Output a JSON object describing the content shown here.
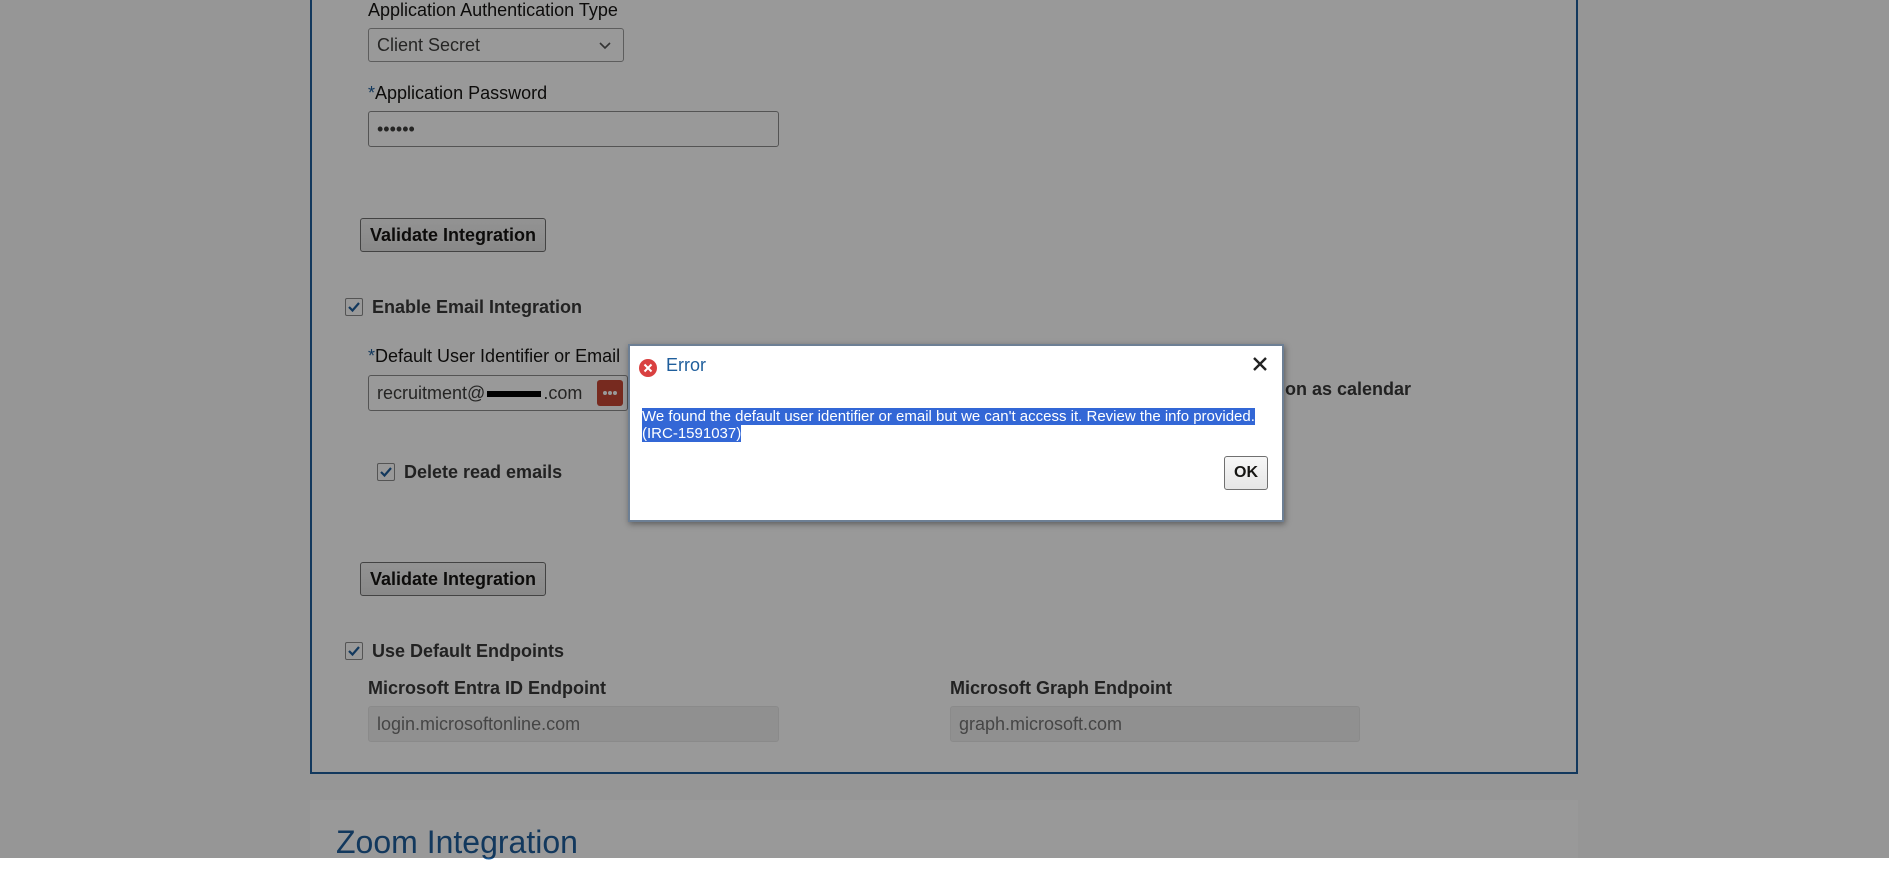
{
  "form": {
    "auth_type_label": "Application Authentication Type",
    "auth_type_value": "Client Secret",
    "password_label": "Application Password",
    "password_value": "••••••",
    "required_marker": "*",
    "validate_button_1": "Validate Integration",
    "enable_email_label": "Enable Email Integration",
    "default_user_label": "Default User Identifier or Email",
    "default_user_value": "recruitment@",
    "default_user_suffix": ".com",
    "right_partial_text": "ion as calendar",
    "delete_read_label": "Delete read emails",
    "validate_button_2": "Validate Integration",
    "use_default_endpoints_label": "Use Default Endpoints",
    "entra_label": "Microsoft Entra ID Endpoint",
    "entra_value": "login.microsoftonline.com",
    "graph_label": "Microsoft Graph Endpoint",
    "graph_value": "graph.microsoft.com"
  },
  "zoom_section": {
    "title": "Zoom Integration"
  },
  "dialog": {
    "title": "Error",
    "message_line1": "We found the default user identifier or email but we can't access it. Review the info provided.",
    "message_line2": "(IRC-1591037)",
    "ok_label": "OK"
  },
  "colors": {
    "accent": "#1f5e9c",
    "error": "#d94040",
    "selection": "#3367d6"
  },
  "icons": [
    "chevron-down-icon",
    "checkmark-icon",
    "password-keyboard-icon",
    "error-icon",
    "close-icon"
  ]
}
